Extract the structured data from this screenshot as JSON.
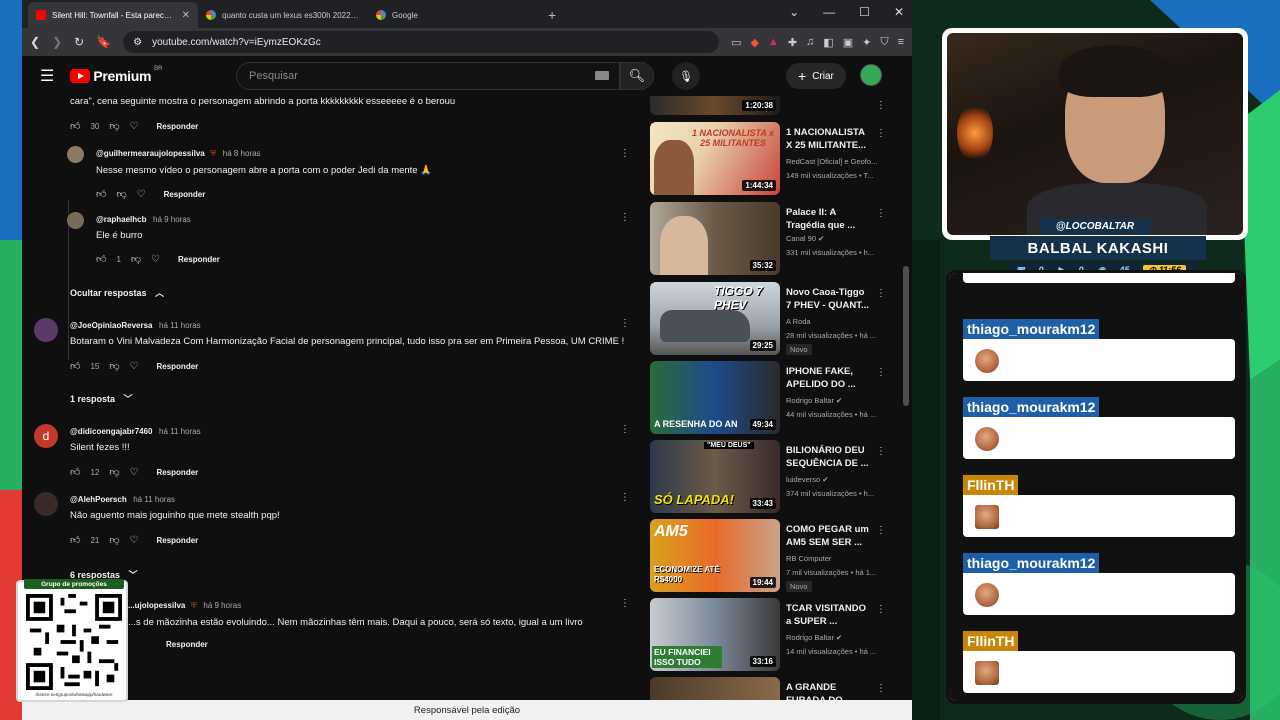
{
  "browser": {
    "tabs": [
      {
        "title": "Silent Hill: Townfall - Esta parecendo jogo",
        "active": true
      },
      {
        "title": "quanto custa um lexus es300h 2022 luxury e",
        "active": false
      },
      {
        "title": "Google",
        "active": false
      }
    ],
    "url": "youtube.com/watch?v=iEymzEOKzGc"
  },
  "youtube": {
    "logo_text": "Premium",
    "region": "BR",
    "search_placeholder": "Pesquisar",
    "create_label": "Criar"
  },
  "comments": [
    {
      "body": "cara\", cena seguinte mostra o personagem abrindo a porta kkkkkkkkk esseeeee é o berouu",
      "likes": "30",
      "reply_label": "Responder"
    },
    {
      "handle": "@guilhermearaujolopessilva",
      "time": "há 8 horas",
      "body": "Nesse mesmo vídeo o personagem abre a porta com o poder Jedi da mente 🙏",
      "likes": "",
      "reply_label": "Responder"
    },
    {
      "handle": "@raphaelhcb",
      "time": "há 9 horas",
      "body": "Ele é burro",
      "likes": "1",
      "reply_label": "Responder"
    },
    {
      "handle": "@JoeOpiniaoReversa",
      "time": "há 11 horas",
      "body": "Botaram o Vini Malvadeza Com Harmonização Facial de personagem principal, tudo isso pra ser em Primeira Pessoa, UM CRIME !",
      "likes": "15",
      "reply_label": "Responder"
    },
    {
      "handle": "@didicoengajabr7460",
      "time": "há 11 horas",
      "body": "Silent fezes !!!",
      "likes": "12",
      "reply_label": "Responder",
      "avatar_letter": "d"
    },
    {
      "handle": "@AlehPoersch",
      "time": "há 11 horas",
      "body": "Não aguento mais joguinho que mete stealth pqp!",
      "likes": "21",
      "reply_label": "Responder"
    },
    {
      "handle": "...ujolopessilva",
      "time": "há 9 horas",
      "body": "...s de mãozinha estão evoluindo... Nem mãozinhas têm mais. Daqui a pouco, será só texto, igual a um livro",
      "likes": "",
      "reply_label": "Responder"
    }
  ],
  "toggles": {
    "hide_replies": "Ocultar respostas",
    "one_reply": "1 resposta",
    "six_replies": "6 respostas"
  },
  "sidebar": [
    {
      "title": "",
      "channel": "",
      "meta": "",
      "duration": "1:20:38"
    },
    {
      "title": "1 NACIONALISTA X 25 MILITANTE...",
      "channel": "RedCast [Oficial] e Geofo...",
      "meta": "149 mil visualizações • T...",
      "duration": "1:44:34",
      "thumb_text": "1 NACIONALISTA x 25 MILITANTES"
    },
    {
      "title": "Palace II: A Tragédia que ...",
      "channel": "Canal 90 ✔",
      "meta": "331 mil visualizações • h...",
      "duration": "35:32"
    },
    {
      "title": "Novo Caoa-Tiggo 7 PHEV - QUANT...",
      "channel": "A Roda",
      "meta": "28 mil visualizações • há ...",
      "duration": "29:25",
      "badge": "Novo",
      "thumb_text": "TIGGO 7 PHEV"
    },
    {
      "title": "IPHONE FAKE, APELIDO DO ...",
      "channel": "Rodrigo Baltar ✔",
      "meta": "44 mil visualizações • há ...",
      "duration": "49:34",
      "thumb_text": "A RESENHA DO AN"
    },
    {
      "title": "BILIONÁRIO DEU SEQUÊNCIA DE ...",
      "channel": "luideverso ✔",
      "meta": "374 mil visualizações • h...",
      "duration": "33:43",
      "thumb_text": "SÓ LAPADA!",
      "thumb_text2": "\"MEU DEUS\""
    },
    {
      "title": "COMO PEGAR um AM5 SEM SER ...",
      "channel": "RB Computer",
      "meta": "7 mil visualizações • há 1...",
      "duration": "19:44",
      "badge": "Novo",
      "thumb_text": "ECONOMIZE ATÉ R$4000",
      "thumb_text2": "AM5"
    },
    {
      "title": "TCAR VISITANDO a SUPER ...",
      "channel": "Rodrigo Baltar ✔",
      "meta": "14 mil visualizações • há ...",
      "duration": "33:16",
      "thumb_text": "EU FINANCIEI ISSO TUDO"
    },
    {
      "title": "A GRANDE FURADA DO ...",
      "channel": "",
      "meta": "",
      "duration": ""
    }
  ],
  "status_bar": "Responsável pela edição",
  "stream": {
    "handle": "@LOCOBALTAR",
    "name": "BALBAL KAKASHI",
    "stats": [
      "0",
      "0",
      "45"
    ],
    "clock": "11:56"
  },
  "chat": [
    {
      "user": "thiago_mourakm12",
      "color": "#1e5fa8"
    },
    {
      "user": "thiago_mourakm12",
      "color": "#1e5fa8"
    },
    {
      "user": "FllinTH",
      "color": "#c8860a"
    },
    {
      "user": "thiago_mourakm12",
      "color": "#1e5fa8"
    },
    {
      "user": "FllinTH",
      "color": "#c8860a"
    }
  ],
  "promo": {
    "title": "Grupo de promoções",
    "url": "rbstore.net/grupos/whatsapp/hardware"
  }
}
